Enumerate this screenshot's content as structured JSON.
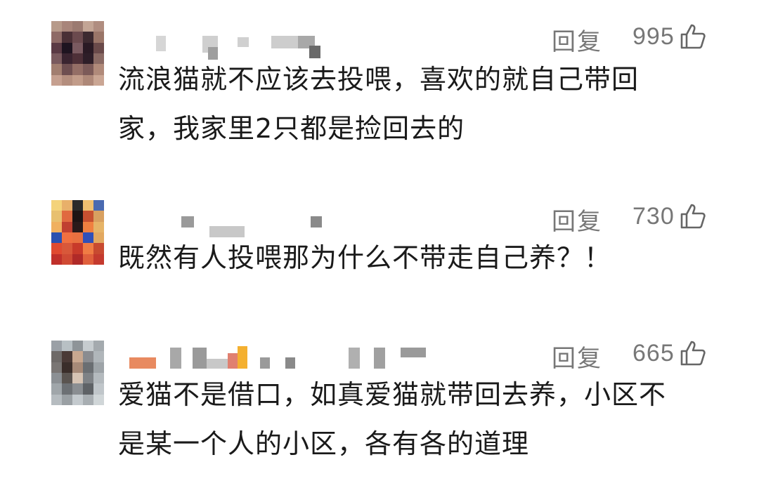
{
  "comments": [
    {
      "reply_label": "回复",
      "likes": "995",
      "text_lines": [
        "流浪猫就不应该去投喂，喜欢的就自己带回",
        "家，我家里2只都是捡回去的"
      ]
    },
    {
      "reply_label": "回复",
      "likes": "730",
      "text_lines": [
        "既然有人投喂那为什么不带走自己养？！"
      ]
    },
    {
      "reply_label": "回复",
      "likes": "665",
      "text_lines": [
        "爱猫不是借口，如真爱猫就带回去养，小区不",
        "是某一个人的小区，各有各的道理"
      ]
    }
  ],
  "icons": {
    "like": "thumbs-up-icon",
    "avatar": "pixelated-avatar",
    "username": "pixelated-username"
  },
  "colors": {
    "text": "#1a1a1a",
    "meta": "#777777",
    "background": "#ffffff"
  }
}
